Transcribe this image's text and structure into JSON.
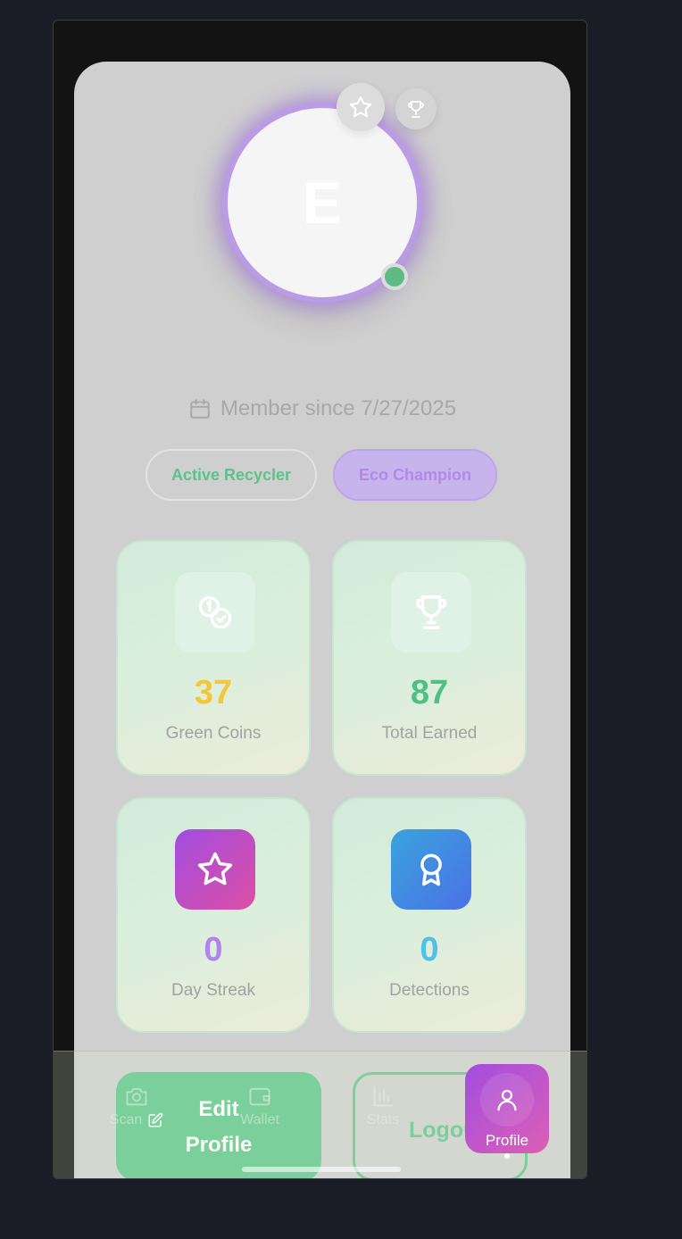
{
  "profile": {
    "initial": "E",
    "member_since": "Member since 7/27/2025",
    "badges": [
      "Active Recycler",
      "Eco Champion"
    ]
  },
  "stats": [
    {
      "value": "37",
      "label": "Green Coins",
      "value_color": "#f4c63a",
      "icon": "coins-icon"
    },
    {
      "value": "87",
      "label": "Total Earned",
      "value_color": "#4fbf82",
      "icon": "trophy-icon"
    },
    {
      "value": "0",
      "label": "Day Streak",
      "value_color": "#b083ee",
      "icon": "star-icon"
    },
    {
      "value": "0",
      "label": "Detections",
      "value_color": "#4fc1e4",
      "icon": "award-icon"
    }
  ],
  "actions": {
    "edit_label_line1": "Edit",
    "edit_label_line2": "Profile",
    "logout_label": "Logout"
  },
  "tabs": [
    {
      "label": "Scan",
      "icon": "camera-icon"
    },
    {
      "label": "Wallet",
      "icon": "wallet-icon"
    },
    {
      "label": "Stats",
      "icon": "bar-chart-icon"
    },
    {
      "label": "Profile",
      "icon": "user-icon",
      "active": true
    }
  ],
  "colors": {
    "accent_green": "#5dc489",
    "accent_purple": "#a24de0"
  }
}
